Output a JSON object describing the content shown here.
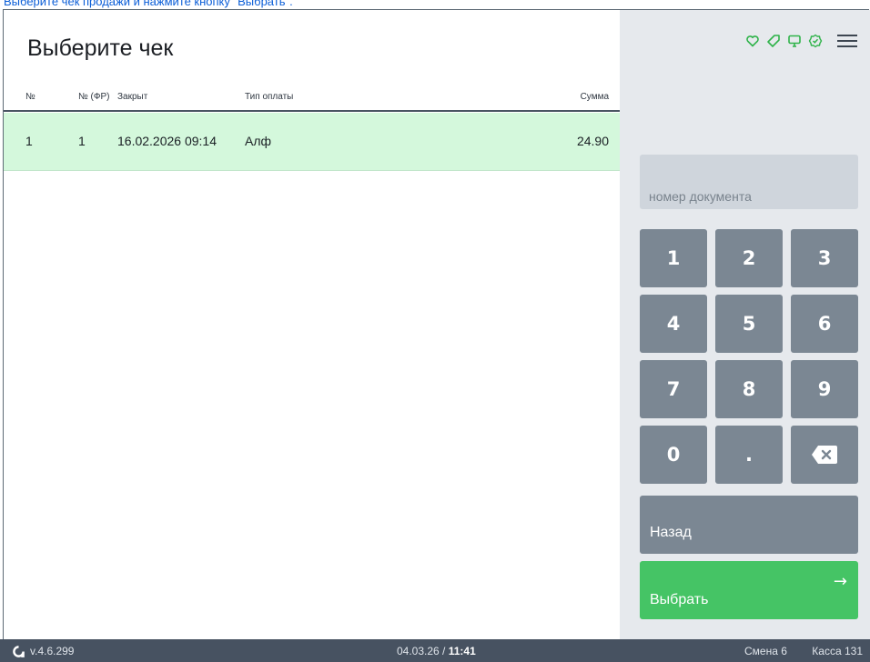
{
  "instruction": "Выберите чек продажи и нажмите кнопку \"Выбрать\".",
  "page_title": "Выберите чек",
  "table": {
    "headers": [
      "№",
      "№ (ФР)",
      "Закрыт",
      "Тип оплаты",
      "Сумма"
    ],
    "rows": [
      {
        "num": "1",
        "fr_num": "1",
        "closed": "16.02.2026 09:14",
        "payment_type": "Алф",
        "sum": "24.90"
      }
    ]
  },
  "status_icons": [
    "heart-icon",
    "tag-icon",
    "monitor-icon",
    "badge-check-icon"
  ],
  "menu_icon": "hamburger-menu-icon",
  "doc_input": {
    "value": "",
    "placeholder": "номер документа"
  },
  "keypad": [
    "1",
    "2",
    "3",
    "4",
    "5",
    "6",
    "7",
    "8",
    "9",
    "0",
    "."
  ],
  "backspace_icon": "backspace-icon",
  "back_label": "Назад",
  "select_label": "Выбрать",
  "select_arrow": "→",
  "footer": {
    "version": "v.4.6.299",
    "date": "04.03.26",
    "date_sep": " / ",
    "time": "11:41",
    "shift": "Смена 6",
    "kassa": "Касса 131"
  },
  "colors": {
    "accent_green": "#45c465",
    "selected_row": "#d4f8dc",
    "key_gray": "#7b8793",
    "panel": "#e6e9ed",
    "footer": "#475261",
    "icon_green": "#2fb34a"
  }
}
